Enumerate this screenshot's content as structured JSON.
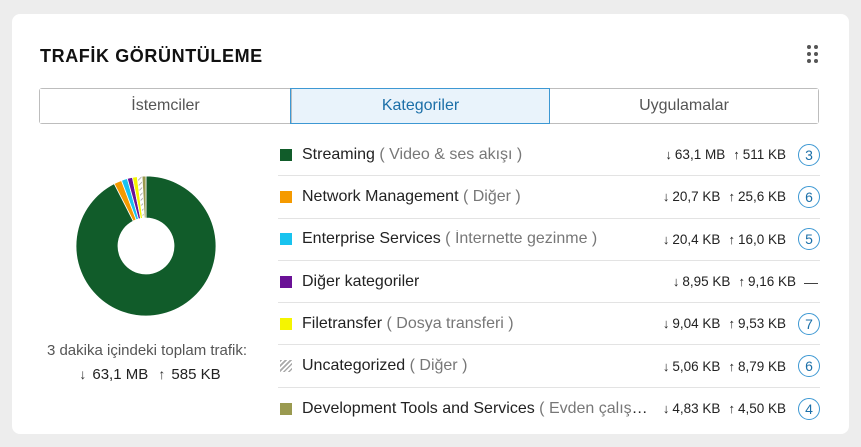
{
  "widget": {
    "title": "TRAFİK GÖRÜNTÜLEME",
    "menu_icon": "drag-dots-icon"
  },
  "tabs": [
    {
      "label": "İstemciler",
      "active": false
    },
    {
      "label": "Kategoriler",
      "active": true
    },
    {
      "label": "Uygulamalar",
      "active": false
    }
  ],
  "summary": {
    "label": "3 dakika içindeki toplam trafik:",
    "down": "63,1 MB",
    "up": "585 KB"
  },
  "colors": {
    "accent": "#3d98d3",
    "streaming": "#115c2a",
    "network": "#f59a00",
    "enterprise": "#18c3ef",
    "other": "#6a1196",
    "filetransfer": "#f5f500",
    "uncategorized": "#cccccc",
    "devtools": "#9a9a50"
  },
  "categories": [
    {
      "name": "Streaming",
      "sub": "( Video & ses akışı )",
      "down": "63,1 MB",
      "up": "511 KB",
      "count": "3",
      "color": "#115c2a",
      "pattern": false,
      "share": 0.925
    },
    {
      "name": "Network Management",
      "sub": "( Diğer )",
      "down": "20,7 KB",
      "up": "25,6 KB",
      "count": "6",
      "color": "#f59a00",
      "pattern": false,
      "share": 0.018
    },
    {
      "name": "Enterprise Services",
      "sub": "( İnternette gezinme )",
      "down": "20,4 KB",
      "up": "16,0 KB",
      "count": "5",
      "color": "#18c3ef",
      "pattern": false,
      "share": 0.014
    },
    {
      "name": "Diğer kategoriler",
      "sub": "",
      "down": "8,95 KB",
      "up": "9,16 KB",
      "count": "—",
      "color": "#6a1196",
      "pattern": false,
      "share": 0.012
    },
    {
      "name": "Filetransfer",
      "sub": "( Dosya transferi )",
      "down": "9,04 KB",
      "up": "9,53 KB",
      "count": "7",
      "color": "#f5f500",
      "pattern": false,
      "share": 0.011
    },
    {
      "name": "Uncategorized",
      "sub": "( Diğer )",
      "down": "5,06 KB",
      "up": "8,79 KB",
      "count": "6",
      "color": "#cccccc",
      "pattern": true,
      "share": 0.011
    },
    {
      "name": "Development Tools and Services",
      "sub": "( Evden çalışma )",
      "down": "4,83 KB",
      "up": "4,50 KB",
      "count": "4",
      "color": "#9a9a50",
      "pattern": false,
      "share": 0.009
    }
  ]
}
